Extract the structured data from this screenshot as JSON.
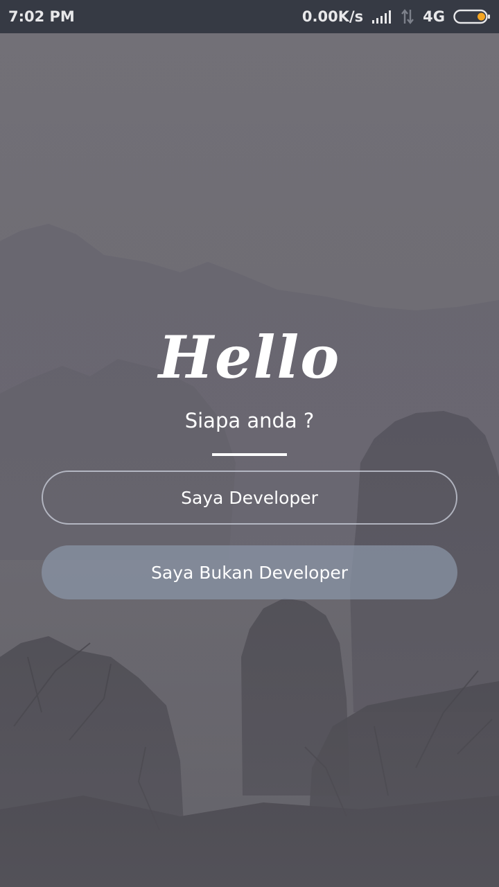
{
  "status_bar": {
    "time": "7:02 PM",
    "network_speed": "0.00K/s",
    "network_type": "4G",
    "icons": [
      "signal-bars-icon",
      "data-transfer-icon",
      "battery-icon"
    ],
    "battery_level": 0.2,
    "battery_color": "#f5a623"
  },
  "main": {
    "title": "Hello",
    "subtitle": "Siapa anda ?",
    "buttons": [
      {
        "label": "Saya Developer",
        "style": "outline"
      },
      {
        "label": "Saya Bukan Developer",
        "style": "filled"
      }
    ]
  },
  "colors": {
    "status_bar_bg": "#363a44",
    "fog": "#6b6a70",
    "text": "#ffffff",
    "filled_button": "#8a96a8"
  }
}
